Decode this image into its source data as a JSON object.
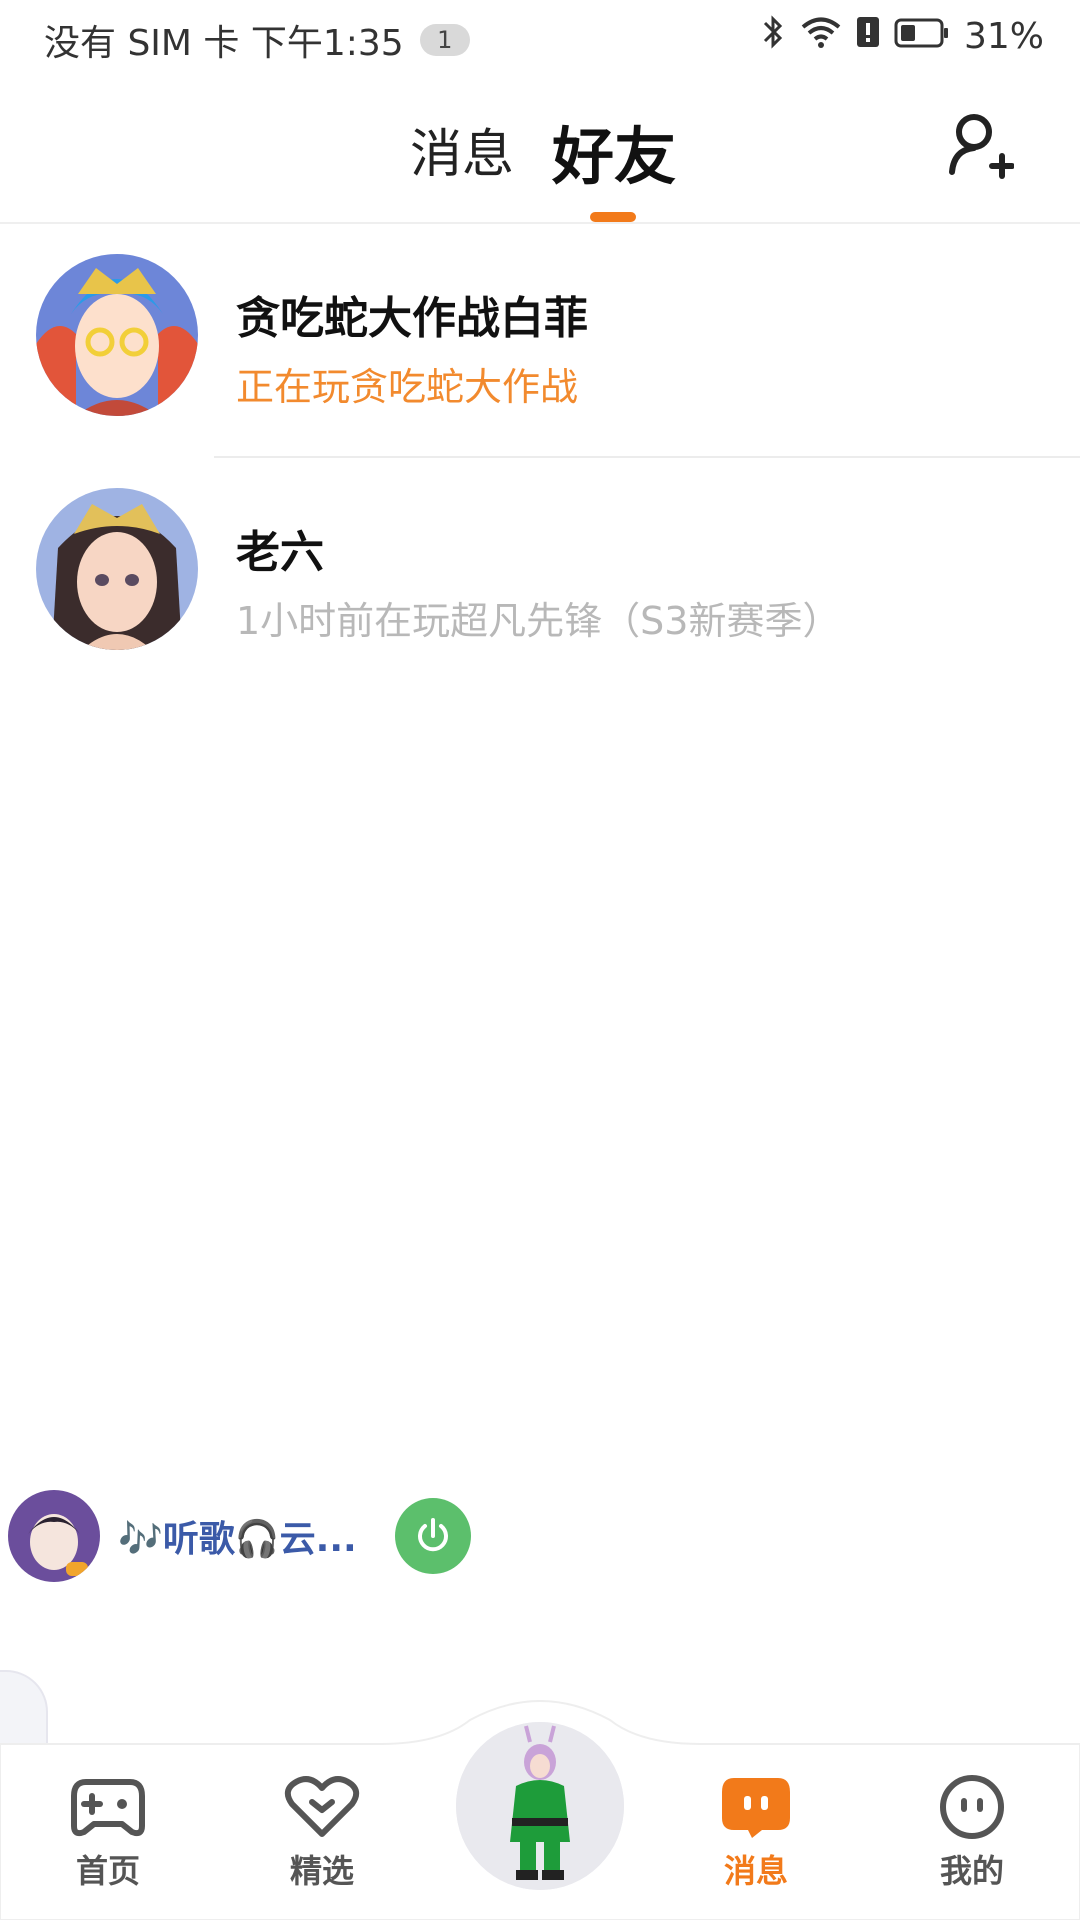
{
  "status_bar": {
    "carrier": "没有 SIM 卡 下午1:35",
    "notification_count": "1",
    "battery": "31%"
  },
  "header": {
    "tab_messages": "消息",
    "tab_friends": "好友",
    "active_tab": "好友",
    "add_friend_icon": "add-user-icon"
  },
  "friends": [
    {
      "name": "贪吃蛇大作战白菲",
      "status": "正在玩贪吃蛇大作战",
      "online": true
    },
    {
      "name": "老六",
      "status": "1小时前在玩超凡先锋（S3新赛季）",
      "online": false
    }
  ],
  "music": {
    "title": "🎶听歌🎧云..."
  },
  "bottom_nav": {
    "items": [
      {
        "label": "首页",
        "icon": "gamepad-icon"
      },
      {
        "label": "精选",
        "icon": "heart-icon"
      },
      {
        "label": "消息",
        "icon": "chat-bubble-icon",
        "active": true
      },
      {
        "label": "我的",
        "icon": "face-icon"
      }
    ]
  },
  "colors": {
    "accent": "#f27a1a",
    "playing": "#f28a2e",
    "muted": "#b8b8b8",
    "power_green": "#5cbf6c"
  }
}
